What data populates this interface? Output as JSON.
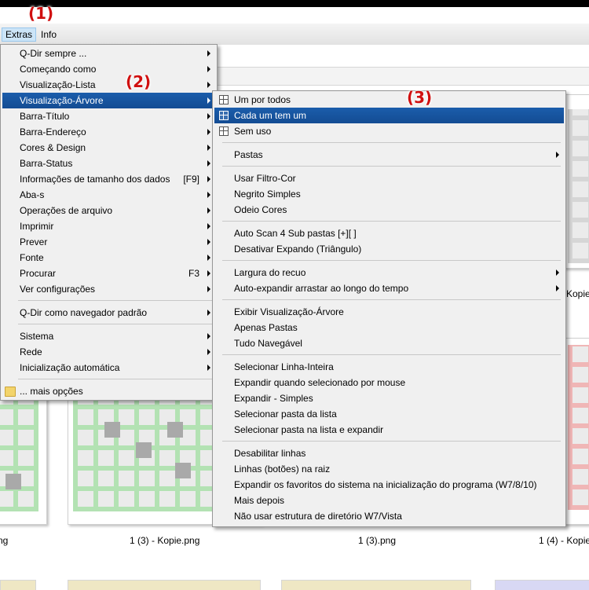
{
  "menubar": {
    "extras": "Extras",
    "info": "Info"
  },
  "callouts": {
    "c1": "(1)",
    "c2": "(2)",
    "c3": "(3)"
  },
  "files": {
    "label_left": "ng",
    "label_a": "1 (3) - Kopie.png",
    "label_b": "1 (3).png",
    "label_c": "1 (4) - Kopie",
    "label_top_right": "Kopie"
  },
  "menu1": {
    "items": [
      {
        "label": "Q-Dir sempre ...",
        "sub": true
      },
      {
        "label": "Começando como",
        "sub": true
      },
      {
        "label": "Visualização-Lista",
        "sub": true
      },
      {
        "label": "Visualização-Árvore",
        "sub": true,
        "selected": true
      },
      {
        "label": "Barra-Título",
        "sub": true
      },
      {
        "label": "Barra-Endereço",
        "sub": true
      },
      {
        "label": "Cores & Design",
        "sub": true
      },
      {
        "label": "Barra-Status",
        "sub": true
      },
      {
        "label": "Informações de tamanho dos dados",
        "shortcut": "[F9]",
        "sub": true
      },
      {
        "label": "Aba-s",
        "sub": true
      },
      {
        "label": "Operações de arquivo",
        "sub": true
      },
      {
        "label": "Imprimir",
        "sub": true
      },
      {
        "label": "Prever",
        "sub": true
      },
      {
        "label": "Fonte",
        "sub": true
      },
      {
        "label": "Procurar",
        "shortcut": "F3",
        "sub": true
      },
      {
        "label": "Ver configurações",
        "sub": true
      },
      {
        "label": "Q-Dir como navegador padrão",
        "sub": true
      },
      {
        "label": "Sistema",
        "sub": true
      },
      {
        "label": "Rede",
        "sub": true
      },
      {
        "label": "Inicialização automática",
        "sub": true
      },
      {
        "label": "... mais opções",
        "icon": "folder-icon"
      }
    ]
  },
  "menu2": {
    "items": [
      {
        "label": "Um por todos",
        "icon": "grid-icon"
      },
      {
        "label": "Cada um tem um",
        "icon": "grid-icon",
        "selected": true
      },
      {
        "label": "Sem uso",
        "icon": "grid-icon"
      },
      {
        "label": "Pastas",
        "sub": true
      },
      {
        "label": "Usar Filtro-Cor"
      },
      {
        "label": "Negrito Simples"
      },
      {
        "label": "Odeio Cores"
      },
      {
        "label": "Auto Scan 4 Sub pastas [+][ ]"
      },
      {
        "label": "Desativar Expando (Triângulo)"
      },
      {
        "label": "Largura do recuo",
        "sub": true
      },
      {
        "label": "Auto-expandir arrastar ao longo do tempo",
        "sub": true
      },
      {
        "label": "Exibir Visualização-Árvore"
      },
      {
        "label": "Apenas Pastas"
      },
      {
        "label": "Tudo Navegável"
      },
      {
        "label": "Selecionar Linha-Inteira"
      },
      {
        "label": "Expandir quando selecionado por mouse"
      },
      {
        "label": "Expandir - Simples"
      },
      {
        "label": "Selecionar pasta da lista"
      },
      {
        "label": "Selecionar pasta na lista e expandir"
      },
      {
        "label": "Desabilitar linhas"
      },
      {
        "label": "Linhas (botões) na raiz"
      },
      {
        "label": "Expandir os favoritos do sistema na inicialização do programa (W7/8/10)"
      },
      {
        "label": "Mais depois"
      },
      {
        "label": "Não usar estrutura de diretório W7/Vista"
      }
    ]
  }
}
